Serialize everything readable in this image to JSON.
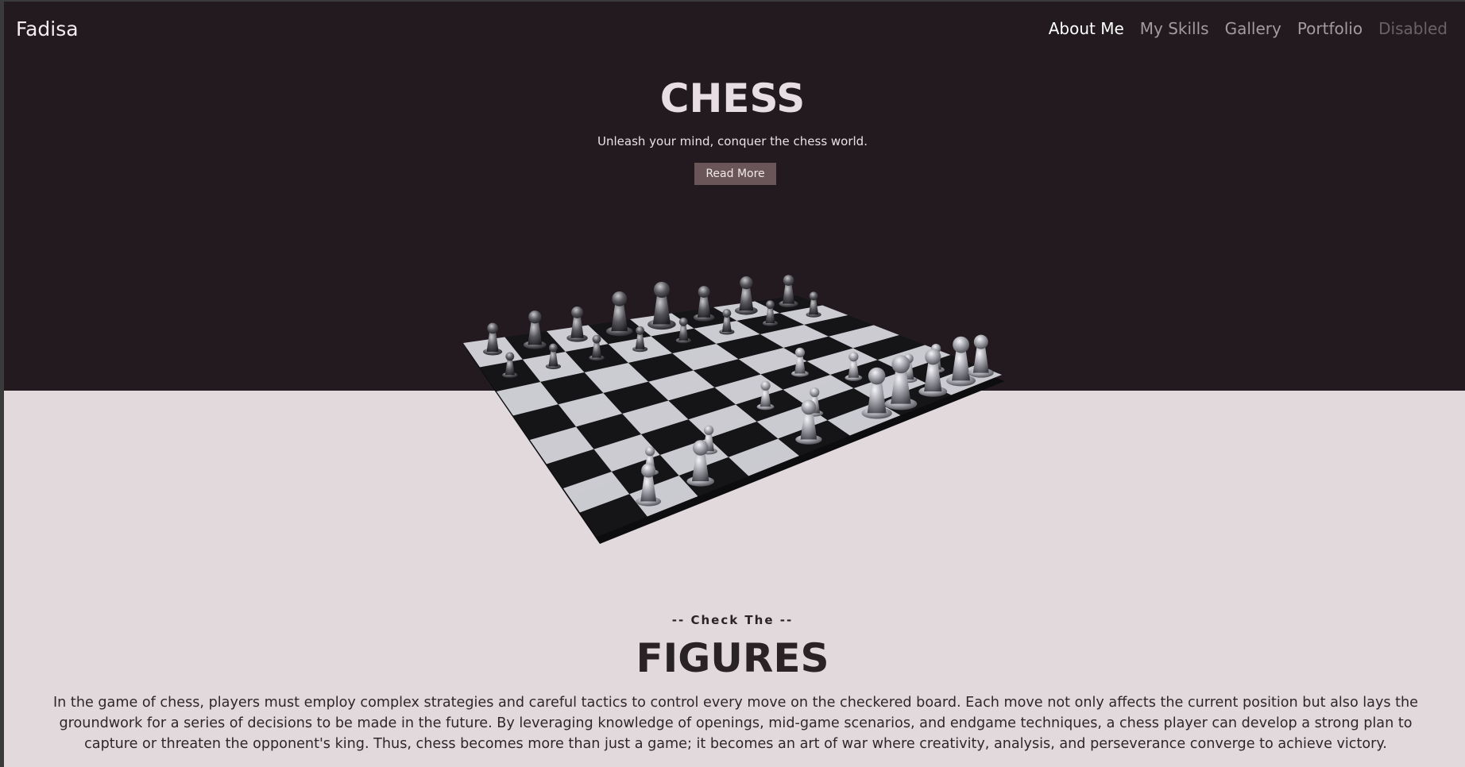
{
  "navbar": {
    "brand": "Fadisa",
    "links": [
      {
        "label": "About Me",
        "state": "active"
      },
      {
        "label": "My Skills",
        "state": "normal"
      },
      {
        "label": "Gallery",
        "state": "normal"
      },
      {
        "label": "Portfolio",
        "state": "normal"
      },
      {
        "label": "Disabled",
        "state": "disabled"
      }
    ]
  },
  "hero": {
    "title": "CHESS",
    "subtitle": "Unleash your mind, conquer the chess world.",
    "button_label": "Read More"
  },
  "section": {
    "eyebrow": "-- Check The --",
    "title": "FIGURES",
    "body": "In the game of chess, players must employ complex strategies and careful tactics to control every move on the checkered board. Each move not only affects the current position but also lays the groundwork for a series of decisions to be made in the future. By leveraging knowledge of openings, mid-game scenarios, and endgame techniques, a chess player can develop a strong plan to capture or threaten the opponent's king. Thus, chess becomes more than just a game; it becomes an art of war where creativity, analysis, and perseverance converge to achieve victory."
  },
  "colors": {
    "hero_bg": "#221a1e",
    "lower_bg": "#e1d9dc",
    "button_bg": "#6a5558"
  }
}
